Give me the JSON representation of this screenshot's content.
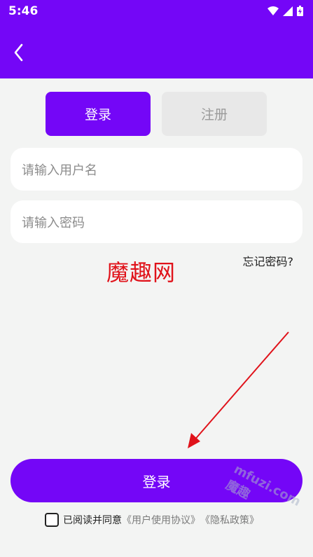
{
  "status": {
    "time": "5:46"
  },
  "tabs": {
    "login": "登录",
    "register": "注册"
  },
  "fields": {
    "username_placeholder": "请输入用户名",
    "password_placeholder": "请输入密码"
  },
  "forgot_password": "忘记密码?",
  "watermark": "魔趣网",
  "login_button": "登录",
  "agreement": {
    "prefix": "已阅读并同意",
    "user_agreement": "《用户使用协议》",
    "privacy_policy": "《隐私政策》"
  },
  "corner_watermark": "mfuzi.com 魔趣",
  "colors": {
    "primary": "#7406f7",
    "arrow": "#e0121a"
  }
}
